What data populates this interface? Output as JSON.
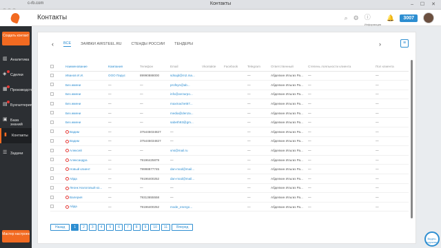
{
  "browser": {
    "url": "c-rb.com",
    "title": "Контакты"
  },
  "header": {
    "page_title": "Контакты",
    "badge": "3007",
    "info_label": "Информация"
  },
  "sidebar": {
    "create_label": "Создать контакт",
    "items": [
      {
        "label": "Аналитика",
        "icon": "chart-icon"
      },
      {
        "label": "Сделки",
        "icon": "deals-icon"
      },
      {
        "label": "Производство",
        "icon": "factory-icon"
      },
      {
        "label": "Бухгалтерия",
        "icon": "accounting-icon"
      },
      {
        "label": "База знаний",
        "icon": "book-icon"
      },
      {
        "label": "Контакты",
        "icon": "contacts-icon"
      },
      {
        "label": "Задачи",
        "icon": "tasks-icon"
      }
    ],
    "master_label": "Мастер настроек"
  },
  "tabs": [
    "ВСЕ",
    "ЗАЯВКИ AIRSTEEL.RU",
    "СТЕНДЫ РОССИИ",
    "ТЕНДЕРЫ"
  ],
  "table": {
    "headers": [
      "Наименование",
      "Компания",
      "Телефон",
      "Email",
      "Vkontakte",
      "Facebook",
      "Telegram",
      "Ответственный",
      "Степень лояльности клиента",
      "Пол клиента"
    ],
    "rows": [
      [
        "Иванов И.И.",
        "ООО Парус",
        "89990888000",
        "sdsajd@m2.ma...",
        "",
        "",
        "—",
        "Абделкин Ильгиз Ра...",
        "—",
        "—"
      ],
      [
        "Без имени",
        "—",
        "—",
        "profsyn@ab...",
        "",
        "",
        "—",
        "Абделкин Ильгиз Ра...",
        "—",
        "—"
      ],
      [
        "Без имени",
        "—",
        "—",
        "info@arcturpo...",
        "",
        "",
        "—",
        "Абделкин Ильгиз Ра...",
        "—",
        "—"
      ],
      [
        "Без имени",
        "—",
        "—",
        "maxmachet67...",
        "",
        "",
        "—",
        "Абделкин Ильгиз Ра...",
        "—",
        "—"
      ],
      [
        "Без имени",
        "—",
        "—",
        "media@denza...",
        "",
        "",
        "—",
        "Абделкин Ильгиз Ра...",
        "—",
        "—"
      ],
      [
        "Без имени",
        "—",
        "—",
        "sabeth93@gm...",
        "",
        "",
        "—",
        "Абделкин Ильгиз Ра...",
        "—",
        "—"
      ],
      [
        "Вадим",
        "—",
        "375445034827",
        "—",
        "",
        "",
        "—",
        "Абделкин Ильгиз Ра...",
        "—",
        "—"
      ],
      [
        "Вадим",
        "—",
        "375445034827",
        "—",
        "",
        "",
        "—",
        "Абделкин Ильгиз Ра...",
        "—",
        "—"
      ],
      [
        "Алексей",
        "—",
        "—",
        "vns@mail.ru",
        "",
        "",
        "—",
        "Абделкин Ильгиз Ра...",
        "—",
        "—"
      ],
      [
        "Александра",
        "—",
        "79196425879",
        "—",
        "",
        "",
        "—",
        "Абделкин Ильгиз Ра...",
        "—",
        "—"
      ],
      [
        "Новый клиент",
        "—",
        "79998877745",
        "dan-mod@mail...",
        "",
        "",
        "—",
        "Абделкин Ильгиз Ра...",
        "—",
        "—"
      ],
      [
        "Айда",
        "—",
        "79196400252",
        "dan-mod@mail...",
        "",
        "",
        "—",
        "Абделкин Ильгиз Ра...",
        "—",
        "—"
      ],
      [
        "Леонк Налоговый ко...",
        "—",
        "—",
        "—",
        "",
        "",
        "—",
        "Абделкин Ильгиз Ра...",
        "—",
        "—"
      ],
      [
        "Валерия",
        "—",
        "79313655558",
        "—",
        "",
        "",
        "—",
        "Абделкин Ильгиз Ра...",
        "—",
        "—"
      ],
      [
        "Айда",
        "—",
        "79196400252",
        "mode_energo...",
        "",
        "",
        "—",
        "Абделкин Ильгиз Ра...",
        "—",
        "—"
      ]
    ],
    "icon_rows": [
      6,
      7,
      8,
      9,
      10,
      11,
      12,
      13,
      14
    ]
  },
  "pager": {
    "prev": "Назад",
    "pages": [
      "1",
      "2",
      "3",
      "4",
      "5",
      "6",
      "7",
      "8",
      "9",
      "10",
      "11"
    ],
    "next": "Вперед",
    "current": "1"
  },
  "help_label": "Видео-подсказка"
}
